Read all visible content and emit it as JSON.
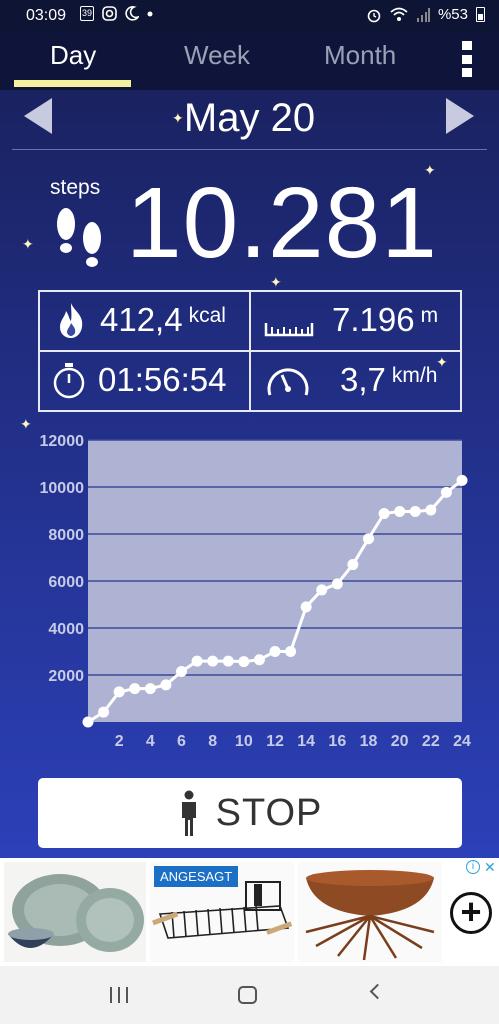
{
  "status_bar": {
    "time": "03:09",
    "notification_badge": "39",
    "battery": "%53",
    "icons_left": [
      "calendar-notification-icon",
      "instagram-icon",
      "moon-icon",
      "dot-icon"
    ],
    "icons_right": [
      "alarm-icon",
      "wifi-icon",
      "signal-icon",
      "battery-icon"
    ]
  },
  "tabs": [
    {
      "label": "Day",
      "active": true
    },
    {
      "label": "Week",
      "active": false
    },
    {
      "label": "Month",
      "active": false
    }
  ],
  "colors": {
    "tab_indicator": "#f4f0a0",
    "background_top": "#1a2260",
    "background_bottom": "#2c40b8",
    "plot_area": "#aeb3d3",
    "line": "#ffffff"
  },
  "date": "May 20",
  "steps": {
    "label": "steps",
    "value": "10.281"
  },
  "stats": {
    "calories": {
      "value": "412,4",
      "unit": "kcal",
      "icon": "flame-icon"
    },
    "distance": {
      "value": "7.196",
      "unit": "m",
      "icon": "ruler-icon"
    },
    "duration": {
      "value": "01:56:54",
      "icon": "stopwatch-icon"
    },
    "speed": {
      "value": "3,7",
      "unit": "km/h",
      "icon": "speedometer-icon"
    }
  },
  "chart_data": {
    "type": "line",
    "title": "",
    "xlabel": "",
    "ylabel": "",
    "x": [
      0,
      1,
      2,
      3,
      4,
      5,
      6,
      7,
      8,
      9,
      10,
      11,
      12,
      13,
      14,
      15,
      16,
      17,
      18,
      19,
      20,
      21,
      22,
      23,
      24
    ],
    "x_ticks": [
      2,
      4,
      6,
      8,
      10,
      12,
      14,
      16,
      18,
      20,
      22,
      24
    ],
    "y_ticks": [
      2000,
      4000,
      6000,
      8000,
      10000,
      12000
    ],
    "ylim": [
      0,
      12000
    ],
    "xlim": [
      0,
      24
    ],
    "grid": true,
    "series": [
      {
        "values": [
          0,
          420,
          1280,
          1420,
          1420,
          1580,
          2150,
          2590,
          2590,
          2590,
          2570,
          2650,
          3000,
          3000,
          4900,
          5620,
          5880,
          6700,
          7800,
          8870,
          8960,
          8960,
          9020,
          9770,
          10281
        ]
      }
    ]
  },
  "stop_button": {
    "label": "STOP",
    "icon": "person-icon"
  },
  "ad": {
    "badge": "ANGESAGT",
    "tiles": [
      "ceramic-plates-image",
      "dish-rack-image",
      "fire-bowl-image"
    ],
    "plus_icon": "plus-circle-icon"
  },
  "nav": {
    "icons": [
      "recent-apps-icon",
      "home-icon",
      "back-icon"
    ]
  }
}
